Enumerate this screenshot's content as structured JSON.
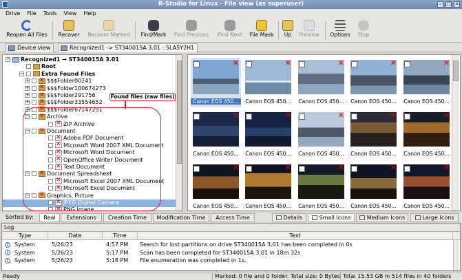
{
  "window": {
    "title": "R-Studio for Linux - File view (as superuser)"
  },
  "menu": [
    "Drive",
    "File",
    "Tools",
    "View",
    "Help"
  ],
  "toolbar": {
    "reopen": "Reopen All Files",
    "recover": "Recover",
    "recover_marked": "Recover Marked",
    "find_mark": "Find/Mark",
    "find_previous": "Find Previous",
    "find_next": "Find Next",
    "file_mask": "File Mask",
    "up": "Up",
    "preview": "Preview",
    "options": "Options",
    "stop": "Stop"
  },
  "tabs": {
    "device_view": "Device view",
    "file_view": "Recognized1 -> ST340015A 3.01 : 5LA5Y2H1"
  },
  "tree": {
    "root_label": "Recognized1 → ST340015A 3.01",
    "items": [
      {
        "label": "Root"
      },
      {
        "label": "Extra Found Files"
      },
      {
        "label": "$$$Folder00241"
      },
      {
        "label": "$$$Folder100674273"
      },
      {
        "label": "$$$Folder291756"
      },
      {
        "label": "$$$Folder33554652"
      },
      {
        "label": "$$$Folder67147251"
      },
      {
        "label": "Archive"
      },
      {
        "label": "ZIP Archive"
      },
      {
        "label": "Document"
      },
      {
        "label": "Adobe PDF Document"
      },
      {
        "label": "Microsoft Word 2007 XML Document"
      },
      {
        "label": "Microsoft Word Document"
      },
      {
        "label": "OpenOffice Writer Document"
      },
      {
        "label": "Text Document"
      },
      {
        "label": "Document Spreadsheet"
      },
      {
        "label": "Microsoft Excel 2007 XML Document"
      },
      {
        "label": "Microsoft Excel Document"
      },
      {
        "label": "Graphics, Picture"
      },
      {
        "label": "JPEG Digital Camera"
      },
      {
        "label": "PNG Image"
      }
    ],
    "callout": "Found files (raw files)"
  },
  "files": {
    "items": [
      {
        "label": "Canon EOS 450...",
        "selected": true
      },
      {
        "label": "Canon EOS 450...",
        "selected": false
      },
      {
        "label": "Canon EOS 450...",
        "selected": false
      },
      {
        "label": "Canon EOS 450...",
        "selected": false
      },
      {
        "label": "Canon EOS 450...",
        "selected": false
      },
      {
        "label": "Canon EOS 450...",
        "selected": false
      },
      {
        "label": "Canon EOS 450...",
        "selected": false
      },
      {
        "label": "Canon EOS 450...",
        "selected": false
      },
      {
        "label": "Canon EOS 450...",
        "selected": false
      },
      {
        "label": "Canon EOS 450...",
        "selected": false
      },
      {
        "label": "Canon EOS 450...",
        "selected": false
      },
      {
        "label": "Canon EOS 450...",
        "selected": false
      },
      {
        "label": "Canon EOS 450...",
        "selected": false
      },
      {
        "label": "Canon EOS 450...",
        "selected": false
      },
      {
        "label": "Canon EOS 450...",
        "selected": false
      }
    ]
  },
  "sortbar": {
    "sorted_by": "Sorted by:",
    "real": "Real",
    "extensions": "Extensions",
    "creation_time": "Creation Time",
    "modification_time": "Modification Time",
    "access_time": "Access Time",
    "details": "Details",
    "small_icons": "Small Icons",
    "medium_icons": "Medium Icons",
    "large_icons": "Large Icons"
  },
  "log": {
    "title": "Log",
    "columns": [
      "Type",
      "Date",
      "Time",
      "Text"
    ],
    "rows": [
      {
        "type": "System",
        "date": "5/26/23",
        "time": "4:57 PM",
        "text": "Search for lost partitions on drive ST340015A 3.01 has been completed in 0s"
      },
      {
        "type": "System",
        "date": "5/26/23",
        "time": "5:17 PM",
        "text": "Scan has been completed for ST340015A 3.01 in 18m 32s"
      },
      {
        "type": "System",
        "date": "5/26/23",
        "time": "5:18 PM",
        "text": "File enumeration was completed in 1s."
      }
    ]
  },
  "status": {
    "ready": "Ready",
    "marked": "Marked: 0 file and 0 folder. Total size: 0 Bytes",
    "total": "Total 15.53 GB in 514 files in 40 folders"
  },
  "colors": {
    "callout": "#dd2222",
    "selection": "#3f78c4",
    "delete_mark": "#dd0000"
  }
}
